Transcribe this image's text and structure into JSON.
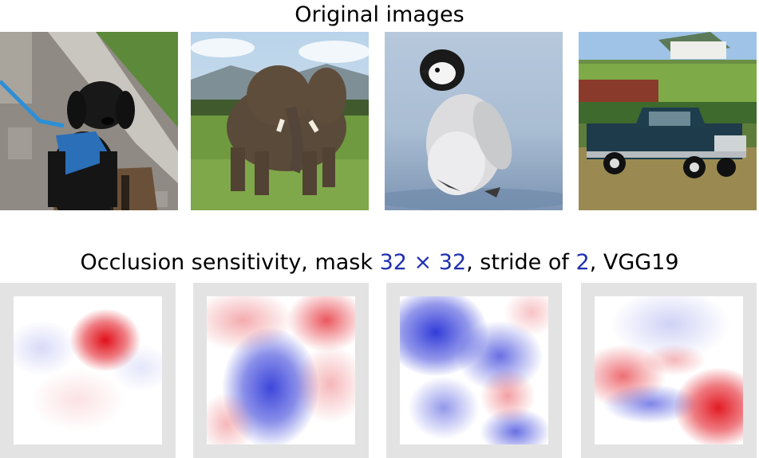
{
  "section1": {
    "title": "Original images",
    "images": [
      {
        "icon": "dog-photo"
      },
      {
        "icon": "elephant-photo"
      },
      {
        "icon": "penguin-chick-photo"
      },
      {
        "icon": "pickup-truck-photo"
      }
    ]
  },
  "section2": {
    "title_prefix": "Occlusion sensitivity, mask ",
    "mask_a": "32",
    "times": " × ",
    "mask_b": "32",
    "title_middle": ", stride of ",
    "stride": "2",
    "title_suffix": ", VGG19",
    "maps": [
      {
        "icon": "dog-occlusion-heatmap"
      },
      {
        "icon": "elephant-occlusion-heatmap"
      },
      {
        "icon": "penguin-occlusion-heatmap"
      },
      {
        "icon": "truck-occlusion-heatmap"
      }
    ]
  },
  "colors": {
    "positive": "#e0141c",
    "negative": "#2233d8",
    "border": "#e3e3e3",
    "accent_text": "#1f2fb0"
  }
}
